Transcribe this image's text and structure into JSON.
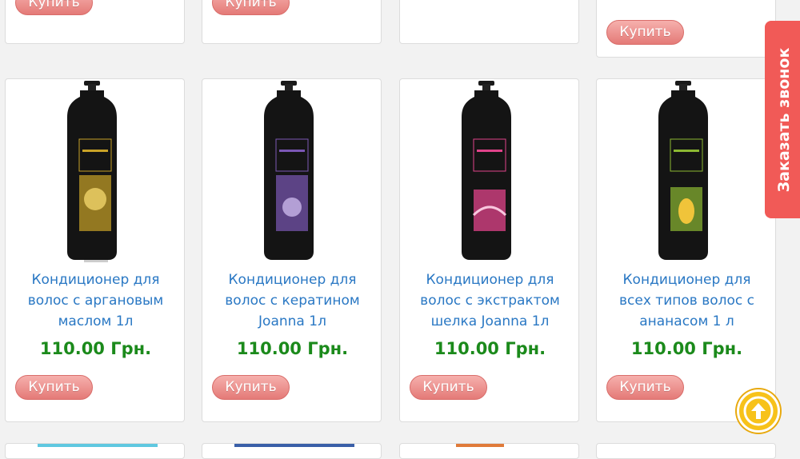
{
  "top_row": {
    "buy_label": "Купить"
  },
  "products": [
    {
      "title": "Кондиционер для волос с аргановым маслом 1л",
      "price": "110.00 Грн.",
      "buy_label": "Купить",
      "label_color": "#c9a227"
    },
    {
      "title": "Кондиционер для волос с кератином Joanna 1л",
      "price": "110.00 Грн.",
      "buy_label": "Купить",
      "label_color": "#7b57b5"
    },
    {
      "title": "Кондиционер для волос с экстрактом шелка Joanna 1л",
      "price": "110.00 Грн.",
      "buy_label": "Купить",
      "label_color": "#e0438a"
    },
    {
      "title": "Кондиционер для всех типов волос с ананасом 1 л",
      "price": "110.00 Грн.",
      "buy_label": "Купить",
      "label_color": "#8cb832"
    }
  ],
  "callback": {
    "label": "Заказать звонок"
  },
  "scroll_top": {
    "icon": "arrow-up-circle-icon"
  },
  "colors": {
    "link": "#2a78c4",
    "price": "#1b8a1b",
    "button": "#e47a77",
    "callback": "#f15a57",
    "scroll_top": "#f7c21a"
  }
}
